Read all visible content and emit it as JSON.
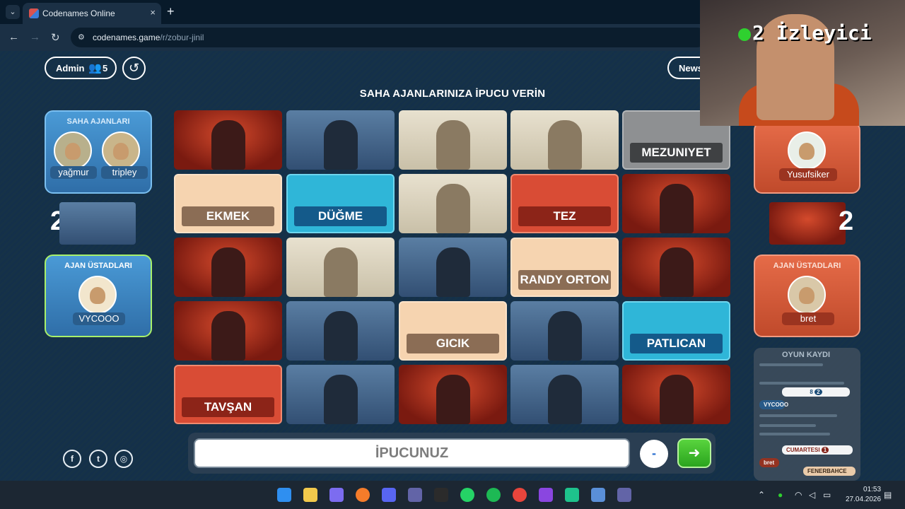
{
  "browser": {
    "tab_title": "Codenames Online",
    "close_glyph": "×",
    "new_tab_glyph": "+",
    "url_host": "codenames.game",
    "url_path": "/r/zobur-jinil"
  },
  "header": {
    "admin_label": "Admin",
    "player_count": "5",
    "news_label": "News"
  },
  "instruction": "SAHA AJANLARINIZA İPUCU VERİN",
  "blue_team": {
    "operatives_title": "SAHA AJANLARI",
    "operatives": [
      "yağmur",
      "tripley"
    ],
    "score": "2",
    "spymasters_title": "AJAN ÜSTADLARI",
    "spymaster": "VYCOOO"
  },
  "red_team": {
    "operative": "Yusufsiker",
    "score": "2",
    "spymasters_title": "AJAN ÜSTADLARI",
    "spymaster": "bret"
  },
  "board": {
    "cards": [
      {
        "type": "red-image",
        "word": ""
      },
      {
        "type": "blue-image",
        "word": ""
      },
      {
        "type": "neutral-image",
        "word": ""
      },
      {
        "type": "neutral-image",
        "word": ""
      },
      {
        "type": "grey-word",
        "word": "MEZUNIYET"
      },
      {
        "type": "base-word",
        "word": "EKMEK"
      },
      {
        "type": "blue-word",
        "word": "DÜĞME"
      },
      {
        "type": "neutral-image",
        "word": ""
      },
      {
        "type": "red-word",
        "word": "TEZ"
      },
      {
        "type": "red-image",
        "word": ""
      },
      {
        "type": "red-image",
        "word": ""
      },
      {
        "type": "neutral-image",
        "word": ""
      },
      {
        "type": "blue-image",
        "word": ""
      },
      {
        "type": "base-word",
        "word": "RANDY ORTON"
      },
      {
        "type": "red-image",
        "word": ""
      },
      {
        "type": "red-image",
        "word": ""
      },
      {
        "type": "blue-image",
        "word": ""
      },
      {
        "type": "base-word",
        "word": "GICIK"
      },
      {
        "type": "blue-image",
        "word": ""
      },
      {
        "type": "blue-word",
        "word": "PATLICAN"
      },
      {
        "type": "red-word",
        "word": "TAVŞAN"
      },
      {
        "type": "blue-image",
        "word": ""
      },
      {
        "type": "red-image",
        "word": ""
      },
      {
        "type": "blue-image",
        "word": ""
      },
      {
        "type": "red-image",
        "word": ""
      }
    ]
  },
  "clue": {
    "placeholder": "İPUCUNUZ",
    "count_value": "-",
    "submit_glyph": "➜"
  },
  "social": {
    "facebook_glyph": "f",
    "twitter_glyph": "t",
    "instagram_glyph": "◎"
  },
  "log": {
    "title": "OYUN KAYDI",
    "chip_1": "8",
    "chip_1_count": "2",
    "chip_2": "CUMARTESI",
    "chip_2_count": "1",
    "chip_3": "FENERBAHCE",
    "speaker_1": "VYCOOO",
    "speaker_2": "bret"
  },
  "webcam": {
    "viewers_text": "2 İzleyici"
  },
  "taskbar": {
    "time": "01:53",
    "date": "27.04.2026"
  },
  "colors": {
    "red_team": "#d94c35",
    "blue_team": "#2fb6d8",
    "base_card": "#f6d4b0",
    "accent_green": "#59d43e"
  }
}
